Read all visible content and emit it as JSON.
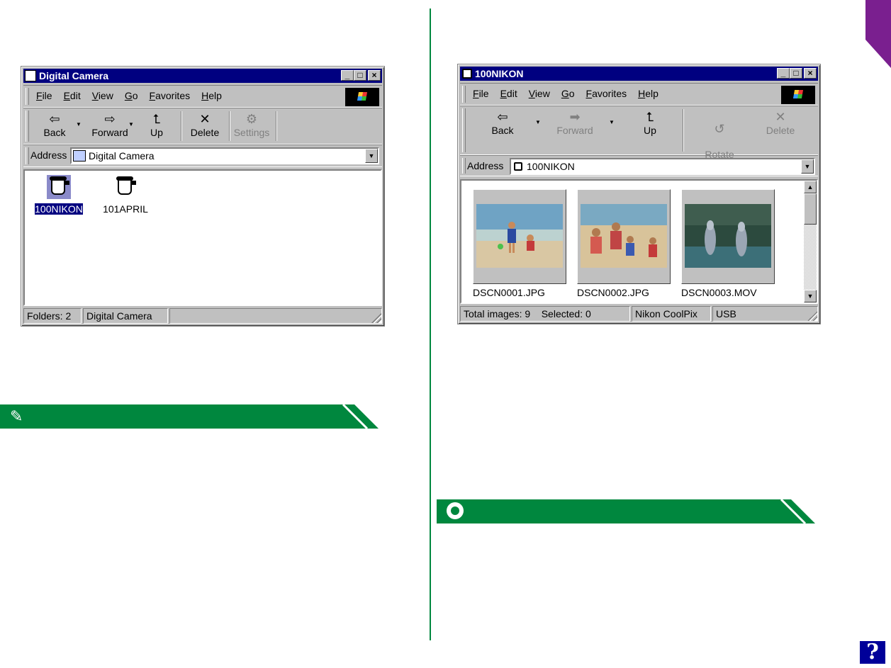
{
  "left_window": {
    "title": "Digital Camera",
    "menu": [
      "File",
      "Edit",
      "View",
      "Go",
      "Favorites",
      "Help"
    ],
    "toolbar": [
      {
        "label": "Back",
        "icon": "back-arrow-icon",
        "enabled": true
      },
      {
        "label": "Forward",
        "icon": "forward-arrow-icon",
        "enabled": true
      },
      {
        "label": "Up",
        "icon": "up-folder-icon",
        "enabled": true
      },
      {
        "label": "Delete",
        "icon": "delete-x-icon",
        "enabled": true
      },
      {
        "label": "Settings",
        "icon": "settings-icon",
        "enabled": false
      }
    ],
    "address_label": "Address",
    "address_value": "Digital Camera",
    "folders": [
      {
        "name": "100NIKON",
        "selected": true
      },
      {
        "name": "101APRIL",
        "selected": false
      }
    ],
    "status": [
      "Folders: 2",
      "Digital Camera",
      ""
    ]
  },
  "right_window": {
    "title": "100NIKON",
    "menu": [
      "File",
      "Edit",
      "View",
      "Go",
      "Favorites",
      "Help"
    ],
    "toolbar": [
      {
        "label": "Back",
        "icon": "back-arrow-icon",
        "enabled": true
      },
      {
        "label": "Forward",
        "icon": "forward-arrow-icon",
        "enabled": false
      },
      {
        "label": "Up",
        "icon": "up-folder-icon",
        "enabled": true
      },
      {
        "label": "Rotate\nSelected",
        "icon": "rotate-icon",
        "enabled": false
      },
      {
        "label": "Delete",
        "icon": "delete-x-icon",
        "enabled": false
      }
    ],
    "address_label": "Address",
    "address_value": "100NIKON",
    "files": [
      "DSCN0001.JPG",
      "DSCN0002.JPG",
      "DSCN0003.MOV"
    ],
    "status": [
      "Total images: 9    Selected: 0",
      "Nikon CoolPix",
      "USB"
    ]
  },
  "colors": {
    "accent_green": "#00873e",
    "title_blue": "#000080",
    "corner_purple": "#7a1f8f"
  },
  "help_button": "?"
}
